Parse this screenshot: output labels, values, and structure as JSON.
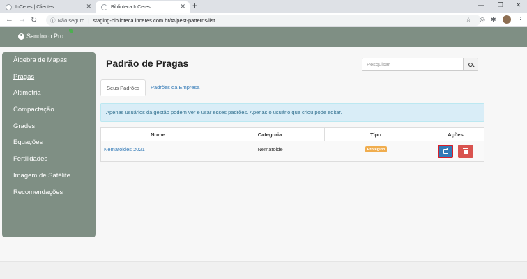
{
  "browser": {
    "tabs": [
      {
        "title": "InCeres | Clientes",
        "active": false
      },
      {
        "title": "Biblioteca InCeres",
        "active": true
      }
    ],
    "address": {
      "security_label": "Não seguro",
      "url": "staging-biblioteca.inceres.com.br/#!/pest-patterns/list"
    }
  },
  "header": {
    "user_name": "Sandro o Pro"
  },
  "sidebar": {
    "items": [
      {
        "label": "Álgebra de Mapas",
        "active": false
      },
      {
        "label": "Pragas",
        "active": true
      },
      {
        "label": "Altimetria",
        "active": false
      },
      {
        "label": "Compactação",
        "active": false
      },
      {
        "label": "Grades",
        "active": false
      },
      {
        "label": "Equações",
        "active": false
      },
      {
        "label": "Fertilidades",
        "active": false
      },
      {
        "label": "Imagem de Satélite",
        "active": false
      },
      {
        "label": "Recomendações",
        "active": false
      }
    ]
  },
  "main": {
    "title": "Padrão de Pragas",
    "search": {
      "placeholder": "Pesquisar",
      "value": ""
    },
    "tabs": [
      {
        "label": "Seus Padrões",
        "active": true
      },
      {
        "label": "Padrões da Empresa",
        "active": false
      }
    ],
    "alert": "Apenas usuários da gestão podem ver e usar esses padrões. Apenas o usuário que criou pode editar.",
    "table": {
      "columns": [
        "Nome",
        "Categoria",
        "Tipo",
        "Ações"
      ],
      "rows": [
        {
          "nome": "Nematoides 2021",
          "categoria": "Nematoide",
          "tipo": "Protegido"
        }
      ]
    }
  },
  "colors": {
    "brand": "#7f8f84",
    "link": "#337ab7",
    "edit_button": "#337ab7",
    "delete_button": "#d9534f",
    "badge": "#f0ad4e"
  }
}
